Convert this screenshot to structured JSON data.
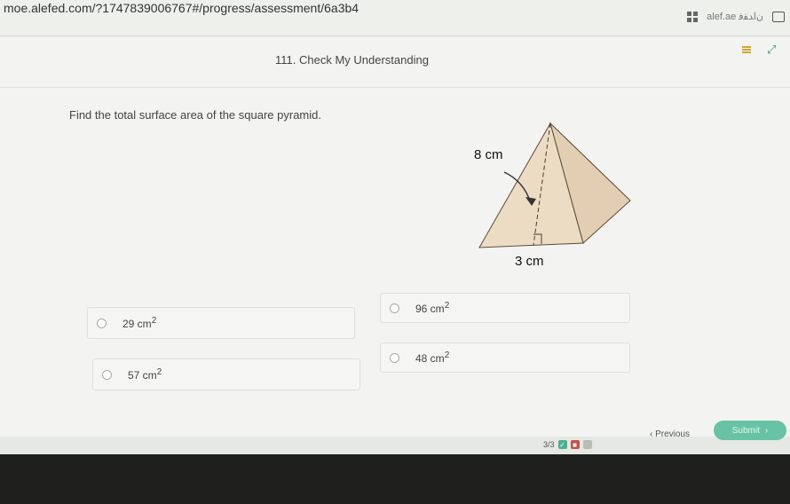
{
  "browser": {
    "url": "moe.alefed.com/?1747839006767#/progress/assessment/6a3b4",
    "right_text": "alef.ae ﻥﺍﺪﻘﻓ"
  },
  "header": {
    "title": "111. Check My Understanding"
  },
  "question": {
    "text": "Find the total surface area of the square pyramid."
  },
  "figure": {
    "slant_label": "8 cm",
    "base_label": "3 cm"
  },
  "options": [
    {
      "label": "29 cm",
      "sup": "2"
    },
    {
      "label": "96 cm",
      "sup": "2"
    },
    {
      "label": "57 cm",
      "sup": "2"
    },
    {
      "label": "48 cm",
      "sup": "2"
    }
  ],
  "footer": {
    "progress": "3/3",
    "previous_label": "Previous",
    "submit_label": "Submit"
  },
  "colors": {
    "accent_green": "#68c2a5",
    "pyramid_face": "#ecdcc4",
    "pyramid_side": "#e2cfb3"
  }
}
